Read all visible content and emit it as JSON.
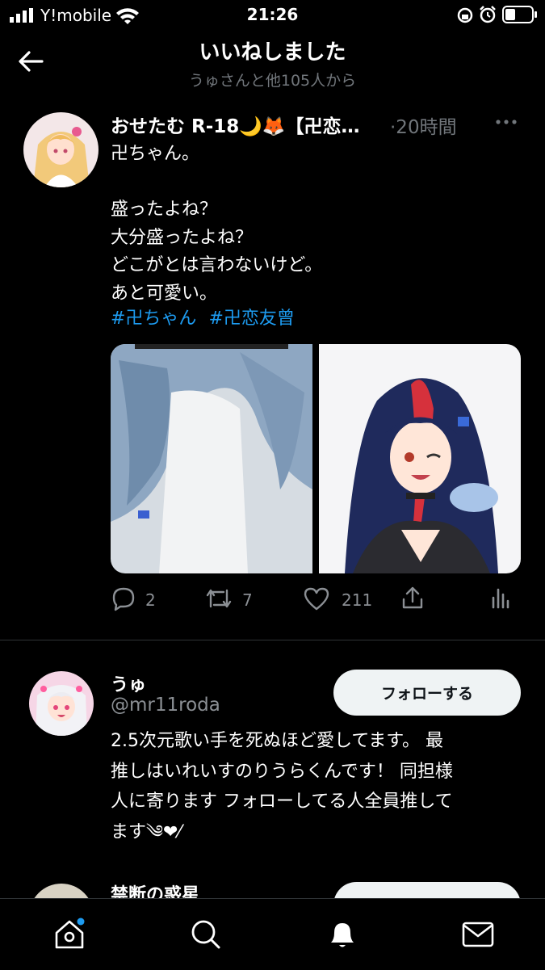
{
  "status_bar": {
    "carrier": "Y!mobile",
    "time": "21:26"
  },
  "header": {
    "title": "いいねしました",
    "subtitle": "うゅさんと他105人から"
  },
  "tweet": {
    "author": "おせたむ R-18🌙🦊【卍恋…",
    "time": "·20時間",
    "lines": [
      "卍ちゃん。",
      "",
      "盛ったよね？",
      "大分盛ったよね？",
      "どこがとは言わないけど。",
      "あと可愛い。"
    ],
    "hashtags": [
      "#卍ちゃん",
      "#卍恋友曾"
    ],
    "replies": "2",
    "retweets": "7",
    "likes": "211"
  },
  "user_card": {
    "name": "うゅ",
    "handle": "@mr11roda",
    "follow_label": "フォローする",
    "bio_lines": [
      "2.5次元歌い手を死ぬほど愛してます。 最",
      "推しはいれいすのりうらくんです！ 同担様",
      "人に寄ります フォローしてる人全員推して",
      "ます༄❤︎⁄"
    ]
  },
  "next_user": {
    "name": "禁断の惑星"
  },
  "colors": {
    "accent": "#1d9bf0",
    "muted": "#71767b",
    "background": "#000000"
  }
}
